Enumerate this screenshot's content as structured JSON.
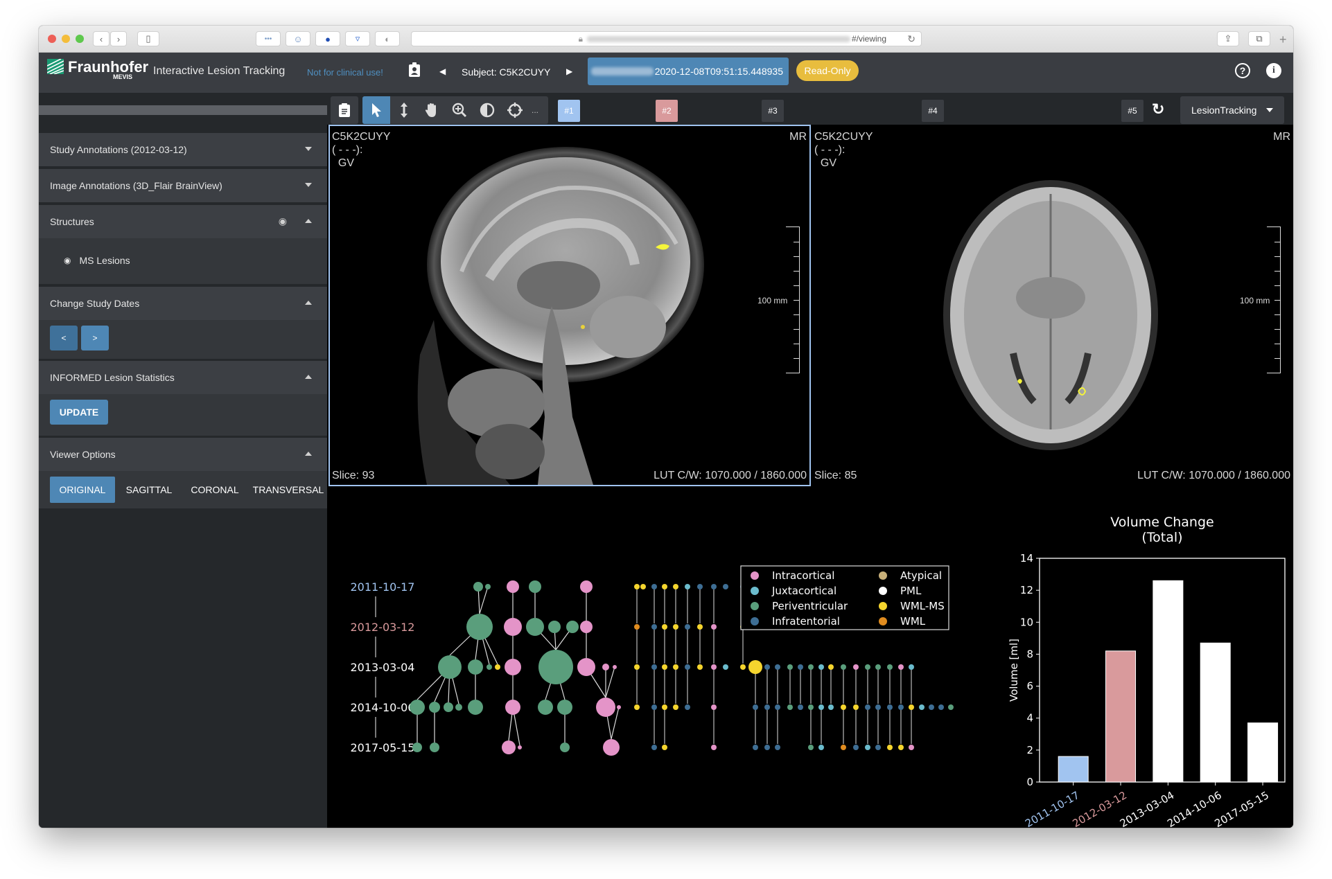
{
  "browser": {
    "url_suffix": "#/viewing",
    "toolbar_icons": [
      "more-icon",
      "ghostery-icon",
      "ublock-icon",
      "pocket-icon",
      "shield-icon"
    ]
  },
  "header": {
    "logo_text": "Fraunhofer",
    "logo_sub": "MEVIS",
    "app_title": "Interactive Lesion Tracking",
    "disclaimer": "Not for clinical use!",
    "subject_label": "Subject: C5K2CUYY",
    "study_datetime": "2020-12-08T09:51:15.448935",
    "readonly_badge": "Read-Only",
    "colors": {
      "accent": "#4e87b5",
      "badge": "#e8bd3e",
      "disclaimer": "#4f8fc0"
    }
  },
  "sidebar": {
    "sections": [
      {
        "title": "Study Annotations (2012-03-12)",
        "expanded": false
      },
      {
        "title": "Image Annotations (3D_Flair BrainView)",
        "expanded": false
      },
      {
        "title": "Structures",
        "expanded": true,
        "items": [
          {
            "label": "MS Lesions",
            "visible": true
          }
        ]
      },
      {
        "title": "Change Study Dates",
        "expanded": true,
        "buttons": [
          "<",
          ">"
        ]
      },
      {
        "title": "INFORMED Lesion Statistics",
        "expanded": true,
        "buttons": [
          "UPDATE"
        ]
      },
      {
        "title": "Viewer Options",
        "expanded": true,
        "tabs": [
          "ORIGINAL",
          "SAGITTAL",
          "CORONAL",
          "TRANSVERSAL"
        ],
        "active_tab": "ORIGINAL"
      }
    ]
  },
  "toolbar": {
    "tools": [
      "notes-icon",
      "pointer-icon",
      "stack-scroll-icon",
      "pan-hand-icon",
      "zoom-icon",
      "contrast-icon",
      "crosshair-icon"
    ],
    "more_label": "...",
    "layouts": [
      {
        "label": "#1",
        "color": "#a1c4f0"
      },
      {
        "label": "#2",
        "color": "#d99a9c"
      },
      {
        "label": "#3",
        "color": "#3a3d42"
      },
      {
        "label": "#4",
        "color": "#3a3d42"
      },
      {
        "label": "#5",
        "color": "#3a3d42"
      }
    ],
    "protocol": "LesionTracking"
  },
  "viewports": [
    {
      "patient": "C5K2CUYY",
      "line2": "( - - -):",
      "line3": "GV",
      "modality": "MR",
      "slice": "Slice: 93",
      "lut": "LUT C/W: 1070.000 / 1860.000",
      "scale": "100 mm",
      "active": true,
      "view": "sagittal"
    },
    {
      "patient": "C5K2CUYY",
      "line2": "( - - -):",
      "line3": "GV",
      "modality": "MR",
      "slice": "Slice: 85",
      "lut": "LUT C/W: 1070.000 / 1860.000",
      "scale": "100 mm",
      "active": false,
      "view": "axial"
    }
  ],
  "lesion_graph": {
    "dates": [
      "2011-10-17",
      "2012-03-12",
      "2013-03-04",
      "2014-10-06",
      "2017-05-15"
    ],
    "date_colors": [
      "#a1c4f0",
      "#d99a9c",
      "#ffffff",
      "#ffffff",
      "#ffffff"
    ],
    "legend": [
      {
        "label": "Intracortical",
        "color": "#e494c8"
      },
      {
        "label": "Juxtacortical",
        "color": "#6bbccd"
      },
      {
        "label": "Periventricular",
        "color": "#5a9e7c"
      },
      {
        "label": "Infratentorial",
        "color": "#3e6e94"
      },
      {
        "label": "Atypical",
        "color": "#c8b07a"
      },
      {
        "label": "PML",
        "color": "#ffffff"
      },
      {
        "label": "WML-MS",
        "color": "#f5d52e"
      },
      {
        "label": "WML",
        "color": "#e08c1f"
      }
    ]
  },
  "chart_data": {
    "type": "bar",
    "title": "Volume Change",
    "subtitle": "(Total)",
    "xlabel": "",
    "ylabel": "Volume [ml]",
    "categories": [
      "2011-10-17",
      "2012-03-12",
      "2013-03-04",
      "2014-10-06",
      "2017-05-15"
    ],
    "values": [
      1.6,
      8.2,
      12.6,
      8.7,
      3.7
    ],
    "bar_colors": [
      "#a1c4f0",
      "#d99a9c",
      "#ffffff",
      "#ffffff",
      "#ffffff"
    ],
    "label_colors": [
      "#a1c4f0",
      "#d99a9c",
      "#ffffff",
      "#ffffff",
      "#ffffff"
    ],
    "ylim": [
      0,
      14
    ],
    "yticks": [
      0,
      2,
      4,
      6,
      8,
      10,
      12,
      14
    ],
    "grid": false
  }
}
